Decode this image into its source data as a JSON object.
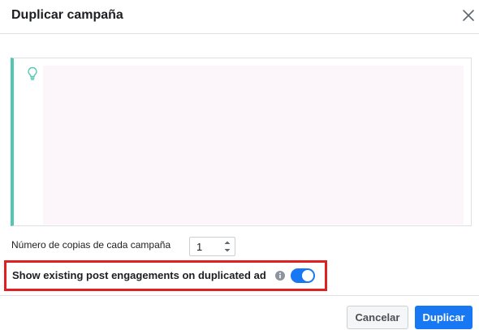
{
  "dialog": {
    "title": "Duplicar campaña",
    "close_icon": "close-icon"
  },
  "tip": {
    "icon": "lightbulb-icon",
    "accent_color": "#54c7b4"
  },
  "copies": {
    "label": "Número de copias de cada campaña",
    "value": "1"
  },
  "engagement": {
    "label": "Show existing post engagements on duplicated ad",
    "info_icon": "info-icon",
    "toggle_on": true,
    "highlight_color": "#e02020"
  },
  "footer": {
    "cancel_label": "Cancelar",
    "primary_label": "Duplicar",
    "primary_color": "#1877f2"
  }
}
